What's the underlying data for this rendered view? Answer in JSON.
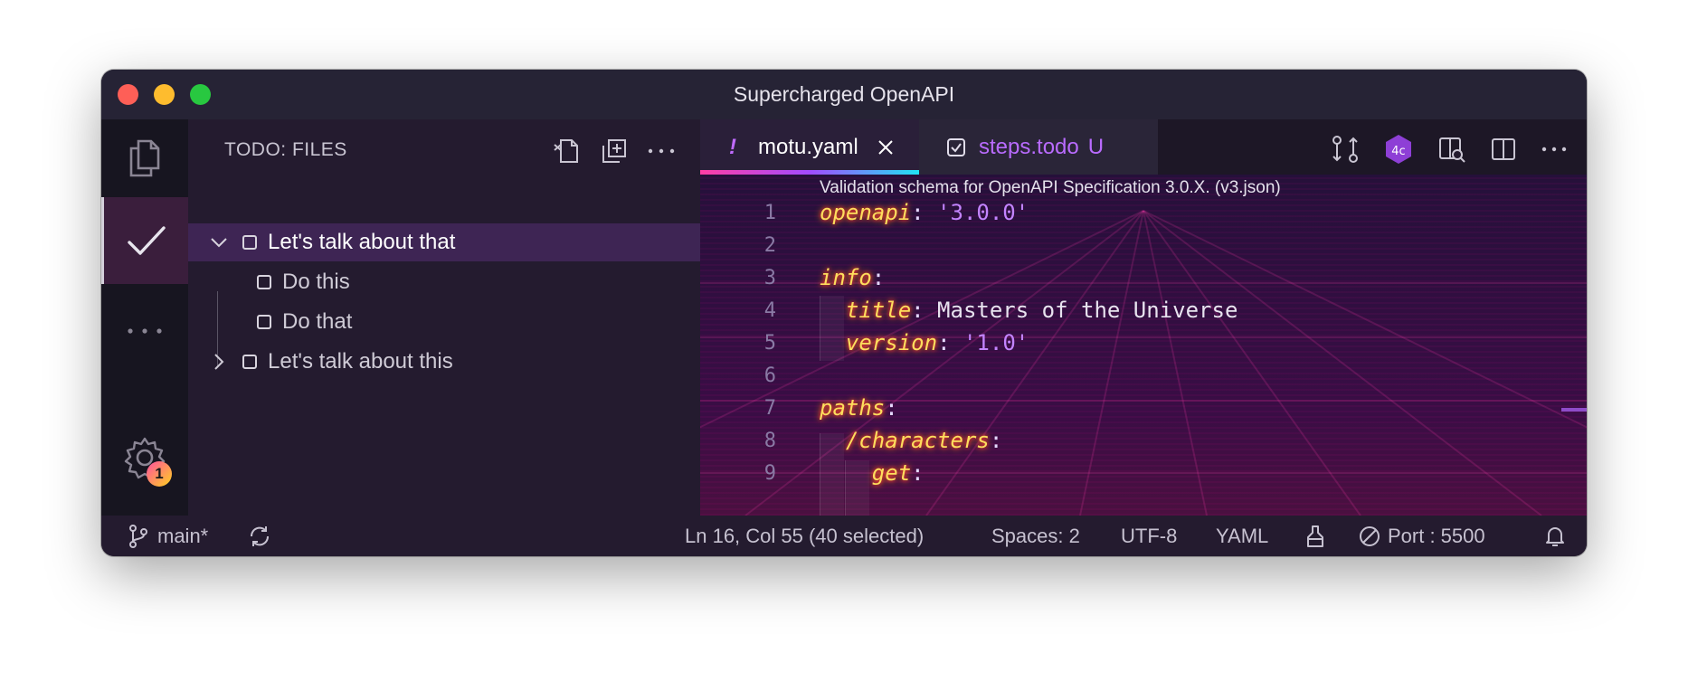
{
  "window": {
    "title": "Supercharged OpenAPI"
  },
  "activity_bar": {
    "settings_badge": "1"
  },
  "sidebar": {
    "title": "TODO: FILES",
    "items": [
      {
        "label": "Let's talk about that"
      },
      {
        "label": "Do this"
      },
      {
        "label": "Do that"
      },
      {
        "label": "Let's talk about this"
      }
    ]
  },
  "tabs": [
    {
      "label": "motu.yaml",
      "marker": "!"
    },
    {
      "label": "steps.todo",
      "marker": "U"
    }
  ],
  "editor": {
    "breadcrumb": "Validation schema for OpenAPI Specification 3.0.X. (v3.json)",
    "lines": [
      {
        "n": "1",
        "key": "openapi",
        "colon": ":",
        "val": " '3.0.0'"
      },
      {
        "n": "2"
      },
      {
        "n": "3",
        "key": "info",
        "colon": ":"
      },
      {
        "n": "4",
        "indent": "  ",
        "key": "title",
        "colon": ":",
        "text": " Masters of the Universe"
      },
      {
        "n": "5",
        "indent": "  ",
        "key": "version",
        "colon": ":",
        "val": " '1.0'"
      },
      {
        "n": "6"
      },
      {
        "n": "7",
        "key": "paths",
        "colon": ":"
      },
      {
        "n": "8",
        "indent": "  ",
        "key": "/characters",
        "colon": ":"
      },
      {
        "n": "9",
        "indent": "    ",
        "key": "get",
        "colon": ":"
      }
    ]
  },
  "statusbar": {
    "branch": "main*",
    "position": "Ln 16, Col 55 (40 selected)",
    "spaces": "Spaces: 2",
    "encoding": "UTF-8",
    "language": "YAML",
    "port": "Port : 5500"
  },
  "colors": {
    "keyword": "#fede5d",
    "string": "#c384ff",
    "accent_pink": "#ff3ea5",
    "accent_cyan": "#20e3f3"
  },
  "icons": [
    "explorer-icon",
    "check-icon",
    "more-icon",
    "gear-icon",
    "new-file-icon",
    "collapse-icon",
    "ellipsis-icon",
    "chevron-down-icon",
    "chevron-right-icon",
    "close-icon",
    "todo-icon",
    "compare-icon",
    "extension-icon",
    "open-preview-icon",
    "split-editor-icon",
    "branch-icon",
    "sync-icon",
    "format-icon",
    "no-port-icon",
    "bell-icon"
  ]
}
